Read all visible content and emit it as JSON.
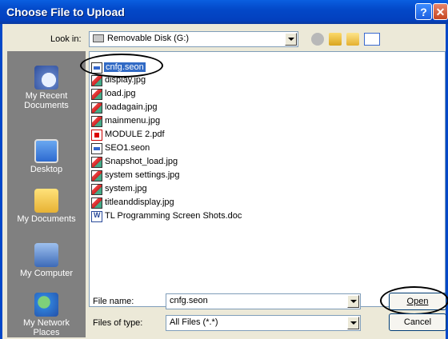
{
  "window": {
    "title": "Choose File to Upload",
    "help_label": "?",
    "close_label": "✕"
  },
  "toolbar": {
    "look_in_label": "Look in:",
    "look_in_value": "Removable Disk (G:)"
  },
  "places": [
    {
      "label": "My Recent Documents"
    },
    {
      "label": "Desktop"
    },
    {
      "label": "My Documents"
    },
    {
      "label": "My Computer"
    },
    {
      "label": "My Network Places"
    }
  ],
  "files": [
    {
      "name": "cnfg.seon",
      "icon": "seon-file-icon",
      "selected": true
    },
    {
      "name": "display.jpg",
      "icon": "image-file-icon"
    },
    {
      "name": "load.jpg",
      "icon": "image-file-icon"
    },
    {
      "name": "loadagain.jpg",
      "icon": "image-file-icon"
    },
    {
      "name": "mainmenu.jpg",
      "icon": "image-file-icon"
    },
    {
      "name": "MODULE 2.pdf",
      "icon": "pdf-file-icon"
    },
    {
      "name": "SEO1.seon",
      "icon": "seon-file-icon"
    },
    {
      "name": "Snapshot_load.jpg",
      "icon": "image-file-icon"
    },
    {
      "name": "system settings.jpg",
      "icon": "image-file-icon"
    },
    {
      "name": "system.jpg",
      "icon": "image-file-icon"
    },
    {
      "name": "titleanddisplay.jpg",
      "icon": "image-file-icon"
    },
    {
      "name": "TL Programming Screen Shots.doc",
      "icon": "word-file-icon"
    }
  ],
  "footer": {
    "file_name_label": "File name:",
    "file_name_value": "cnfg.seon",
    "files_type_label": "Files of type:",
    "files_type_value": "All Files (*.*)",
    "open_label": "Open",
    "cancel_label": "Cancel"
  },
  "colors": {
    "title_bar": "#0348c8",
    "selection": "#316ac5",
    "places_bar": "#808080"
  }
}
